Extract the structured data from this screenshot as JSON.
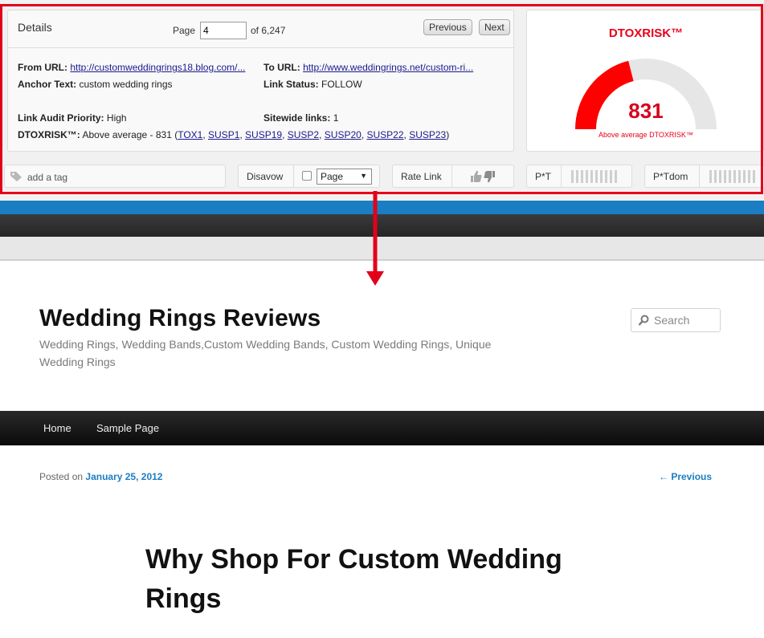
{
  "details": {
    "title": "Details",
    "page_label": "Page",
    "page_value": "4",
    "page_total": "of 6,247",
    "prev_label": "Previous",
    "next_label": "Next",
    "from_url_label": "From URL:",
    "from_url": "http://customweddingrings18.blog.com/...",
    "to_url_label": "To URL:",
    "to_url": "http://www.weddingrings.net/custom-ri...",
    "anchor_label": "Anchor Text:",
    "anchor_value": "custom wedding rings",
    "status_label": "Link Status:",
    "status_value": "FOLLOW",
    "priority_label": "Link Audit Priority:",
    "priority_value": "High",
    "sitewide_label": "Sitewide links:",
    "sitewide_value": "1",
    "dtox_label": "DTOXRISK™:",
    "dtox_value": "Above average - 831 (",
    "dtox_links": [
      "TOX1",
      "SUSP1",
      "SUSP19",
      "SUSP2",
      "SUSP20",
      "SUSP22",
      "SUSP23"
    ],
    "dtox_sep": ", ",
    "dtox_close": ")"
  },
  "gauge": {
    "title": "DTOXRISK™",
    "value": "831",
    "level": 0.42,
    "caption": "Above average DTOXRISK™",
    "fill_color": "#ff0000",
    "track_color": "#e6e6e6"
  },
  "toolbar": {
    "tag_placeholder": "add a tag",
    "disavow_label": "Disavow",
    "disavow_select": "Page",
    "rate_label": "Rate Link",
    "pt_label": "P*T",
    "ptdom_label": "P*Tdom"
  },
  "colors": {
    "frame": "#e3001b",
    "accent_blue": "#1b7ec2"
  },
  "site": {
    "title": "Wedding Rings Reviews",
    "description": "Wedding Rings, Wedding Bands,Custom Wedding Bands, Custom Wedding Rings, Unique Wedding Rings",
    "search_placeholder": "Search",
    "nav": [
      "Home",
      "Sample Page"
    ],
    "posted_prefix": "Posted on",
    "posted_date": "January 25, 2012",
    "prev_link": "← Previous",
    "post_title": "Why Shop For Custom Wedding Rings"
  }
}
